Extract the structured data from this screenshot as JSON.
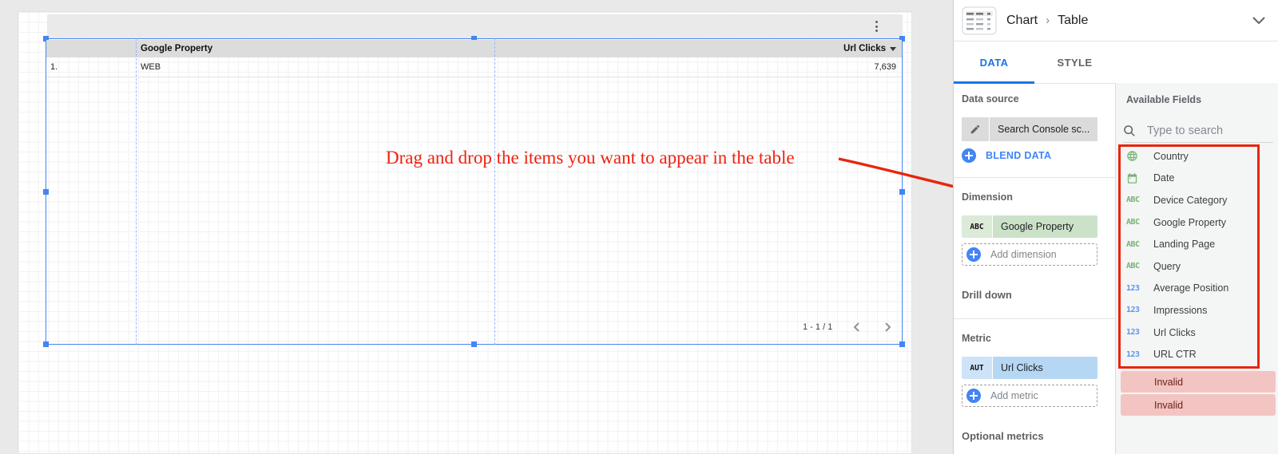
{
  "canvas": {
    "table": {
      "dim_header": "Google Property",
      "metric_header": "Url Clicks",
      "row_index": "1.",
      "row": {
        "google_property": "WEB",
        "url_clicks": "7,639"
      },
      "pagination": "1 - 1 / 1"
    },
    "annotation": "Drag and drop the items you want to appear in the table"
  },
  "panel": {
    "breadcrumb": {
      "parent": "Chart",
      "separator": "›",
      "current": "Table"
    },
    "tabs": {
      "data": "DATA",
      "style": "STYLE"
    },
    "data_source": {
      "label": "Data source",
      "name": "Search Console sc...",
      "blend": "BLEND DATA"
    },
    "dimension": {
      "label": "Dimension",
      "chip_badge": "ABC",
      "chip_name": "Google Property",
      "add": "Add dimension"
    },
    "drill_down_label": "Drill down",
    "metric": {
      "label": "Metric",
      "chip_badge": "AUT",
      "chip_name": "Url Clicks",
      "add": "Add metric"
    },
    "optional_metrics_label": "Optional metrics"
  },
  "fields": {
    "title": "Available Fields",
    "search_placeholder": "Type to search",
    "items": [
      {
        "name": "Country",
        "icon": "globe",
        "badge": ""
      },
      {
        "name": "Date",
        "icon": "calendar",
        "badge": ""
      },
      {
        "name": "Device Category",
        "icon": "text",
        "badge": "ABC"
      },
      {
        "name": "Google Property",
        "icon": "text",
        "badge": "ABC"
      },
      {
        "name": "Landing Page",
        "icon": "text",
        "badge": "ABC"
      },
      {
        "name": "Query",
        "icon": "text",
        "badge": "ABC"
      },
      {
        "name": "Average Position",
        "icon": "number",
        "badge": "123"
      },
      {
        "name": "Impressions",
        "icon": "number",
        "badge": "123"
      },
      {
        "name": "Url Clicks",
        "icon": "number",
        "badge": "123"
      },
      {
        "name": "URL CTR",
        "icon": "number",
        "badge": "123"
      }
    ],
    "invalid": [
      "Invalid",
      "Invalid"
    ]
  },
  "icons": [
    "table-chart-icon",
    "chevron-down-icon",
    "pencil-icon",
    "plus-icon",
    "question-icon",
    "kebab-menu-icon",
    "search-icon",
    "globe-icon",
    "calendar-icon",
    "sort-desc-icon",
    "chevron-left-icon",
    "chevron-right-icon"
  ],
  "colors": {
    "accent_blue": "#1a73e8",
    "selection_blue": "#4285f4",
    "annotation_red": "#e8250e",
    "dimension_green": "#cbe2c9",
    "metric_blue": "#b6d7f3",
    "field_green": "#77b377",
    "field_blue": "#5f94f0",
    "invalid_pink": "#f2c5c2",
    "table_header_gray": "#dcdcdc"
  }
}
